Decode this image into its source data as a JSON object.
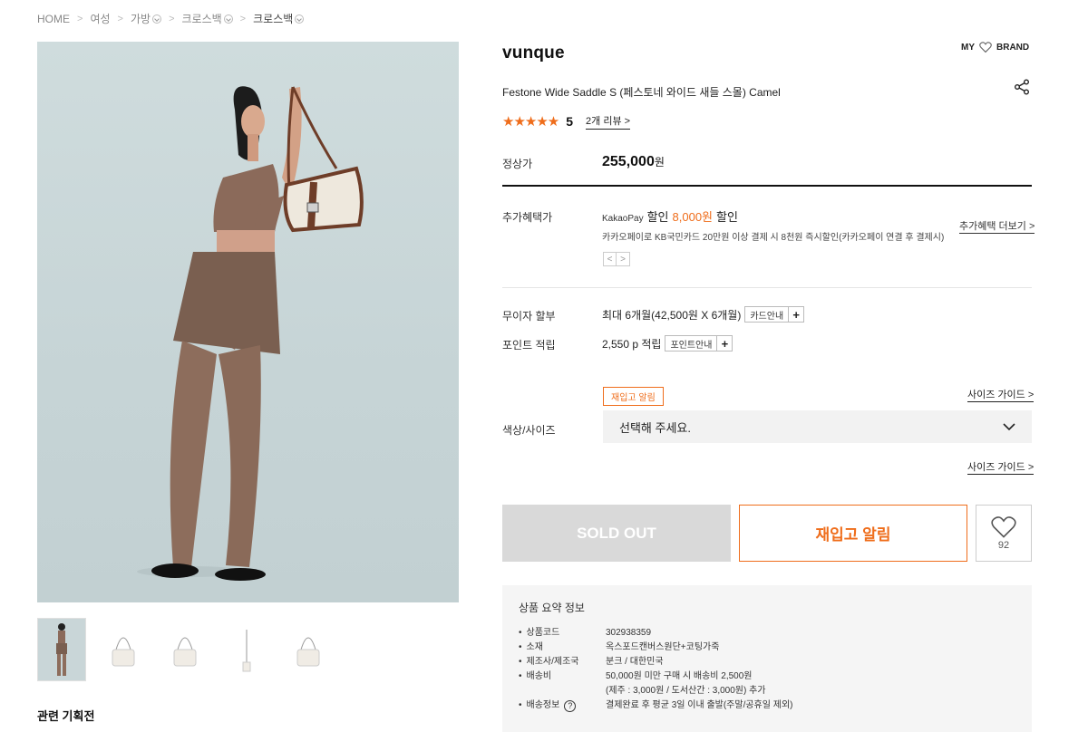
{
  "breadcrumb": [
    {
      "label": "HOME",
      "dropdown": false
    },
    {
      "label": "여성",
      "dropdown": false
    },
    {
      "label": "가방",
      "dropdown": true
    },
    {
      "label": "크로스백",
      "dropdown": true
    },
    {
      "label": "크로스백",
      "dropdown": true
    }
  ],
  "product": {
    "brand": "vunque",
    "my_label": "MY",
    "brand_label": "BRAND",
    "name": "Festone Wide Saddle S (페스토네 와이드 새들 스몰) Camel",
    "stars": "★★★★★",
    "rating": "5",
    "review_link": "2개 리뷰 >"
  },
  "price": {
    "label": "정상가",
    "value": "255,000",
    "unit": "원"
  },
  "benefit": {
    "label": "추가혜택가",
    "kakao_pay": "KakaoPay",
    "discount_prefix": "할인",
    "discount_amount": "8,000원",
    "discount_suffix": "할인",
    "more": "추가혜택 더보기 >",
    "description": "카카오페이로 KB국민카드 20만원 이상 결제 시 8천원 즉시할인(카카오페이 연결 후 결제시)",
    "prev": "<",
    "next": ">"
  },
  "installment": {
    "label": "무이자 할부",
    "value": "최대 6개월(42,500원 X 6개월)",
    "button": "카드안내",
    "plus": "+"
  },
  "points": {
    "label": "포인트 적립",
    "value": "2,550 p 적립",
    "button": "포인트안내",
    "plus": "+"
  },
  "options": {
    "restock_tag": "재입고 알림",
    "size_guide": "사이즈 가이드 >",
    "label": "색상/사이즈",
    "placeholder": "선택해 주세요.",
    "size_guide_bottom": "사이즈 가이드 >"
  },
  "actions": {
    "sold_out": "SOLD OUT",
    "restock": "재입고 알림",
    "like_count": "92"
  },
  "summary": {
    "title": "상품 요약 정보",
    "rows": [
      {
        "key": "상품코드",
        "value": "302938359"
      },
      {
        "key": "소재",
        "value": "옥스포드캔버스원단+코팅가죽"
      },
      {
        "key": "제조사/제조국",
        "value": "분크 / 대한민국"
      },
      {
        "key": "배송비",
        "value": "50,000원 미만 구매 시 배송비 2,500원"
      },
      {
        "key": "",
        "value": "(제주 : 3,000원 / 도서산간 : 3,000원) 추가"
      },
      {
        "key": "배송정보",
        "value": "결제완료 후 평균 3일 이내 출발(주말/공휴일 제외)"
      }
    ],
    "help_icon": "?"
  },
  "related_title": "관련 기획전",
  "colors": {
    "accent": "#ef6d1b",
    "sold_out_bg": "#d9d9d9",
    "summary_bg": "#f5f5f5"
  }
}
